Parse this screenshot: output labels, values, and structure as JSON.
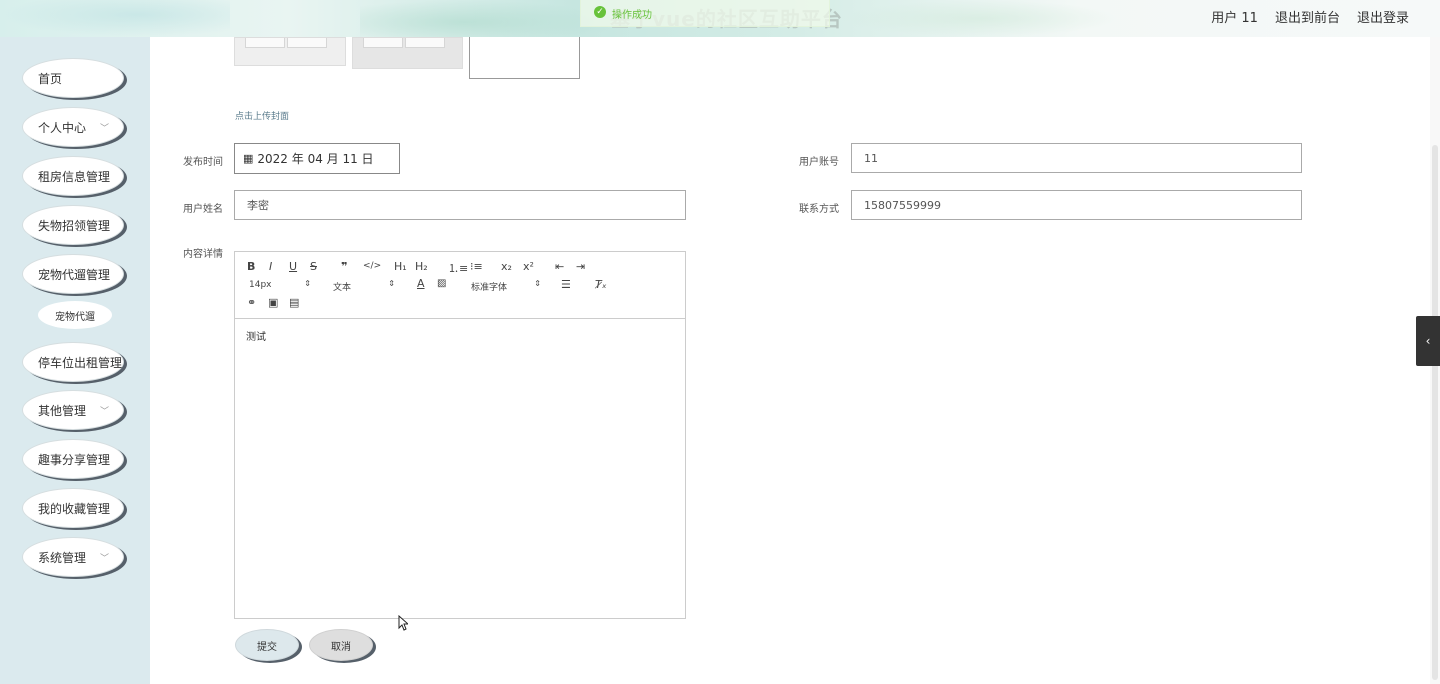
{
  "header": {
    "site_title": "基于vue的社区互助平台",
    "toast": "操作成功",
    "user": "用户 11",
    "links": [
      "退出到前台",
      "退出登录"
    ]
  },
  "sidebar": {
    "items": [
      {
        "label": "首页",
        "has_arrow": false
      },
      {
        "label": "个人中心",
        "has_arrow": true
      },
      {
        "label": "租房信息管理",
        "has_arrow": false
      },
      {
        "label": "失物招领管理",
        "has_arrow": false
      },
      {
        "label": "宠物代遛管理",
        "has_arrow": false
      },
      {
        "label": "停车位出租管理",
        "has_arrow": false
      },
      {
        "label": "其他管理",
        "has_arrow": true
      },
      {
        "label": "趣事分享管理",
        "has_arrow": false
      },
      {
        "label": "我的收藏管理",
        "has_arrow": false
      },
      {
        "label": "系统管理",
        "has_arrow": true
      }
    ],
    "sub_item": "宠物代遛"
  },
  "form": {
    "upload_hint": "点击上传封面",
    "publish_time_label": "发布时间",
    "publish_time_value": "2022 年 04 月 11 日",
    "account_label": "用户账号",
    "account_value": "11",
    "name_label": "用户姓名",
    "name_value": "李密",
    "contact_label": "联系方式",
    "contact_value": "15807559999",
    "content_label": "内容详情",
    "content_value": "测试",
    "toolbar": {
      "size": "14px",
      "header": "文本",
      "font": "标准字体"
    },
    "submit": "提交",
    "cancel": "取消"
  }
}
